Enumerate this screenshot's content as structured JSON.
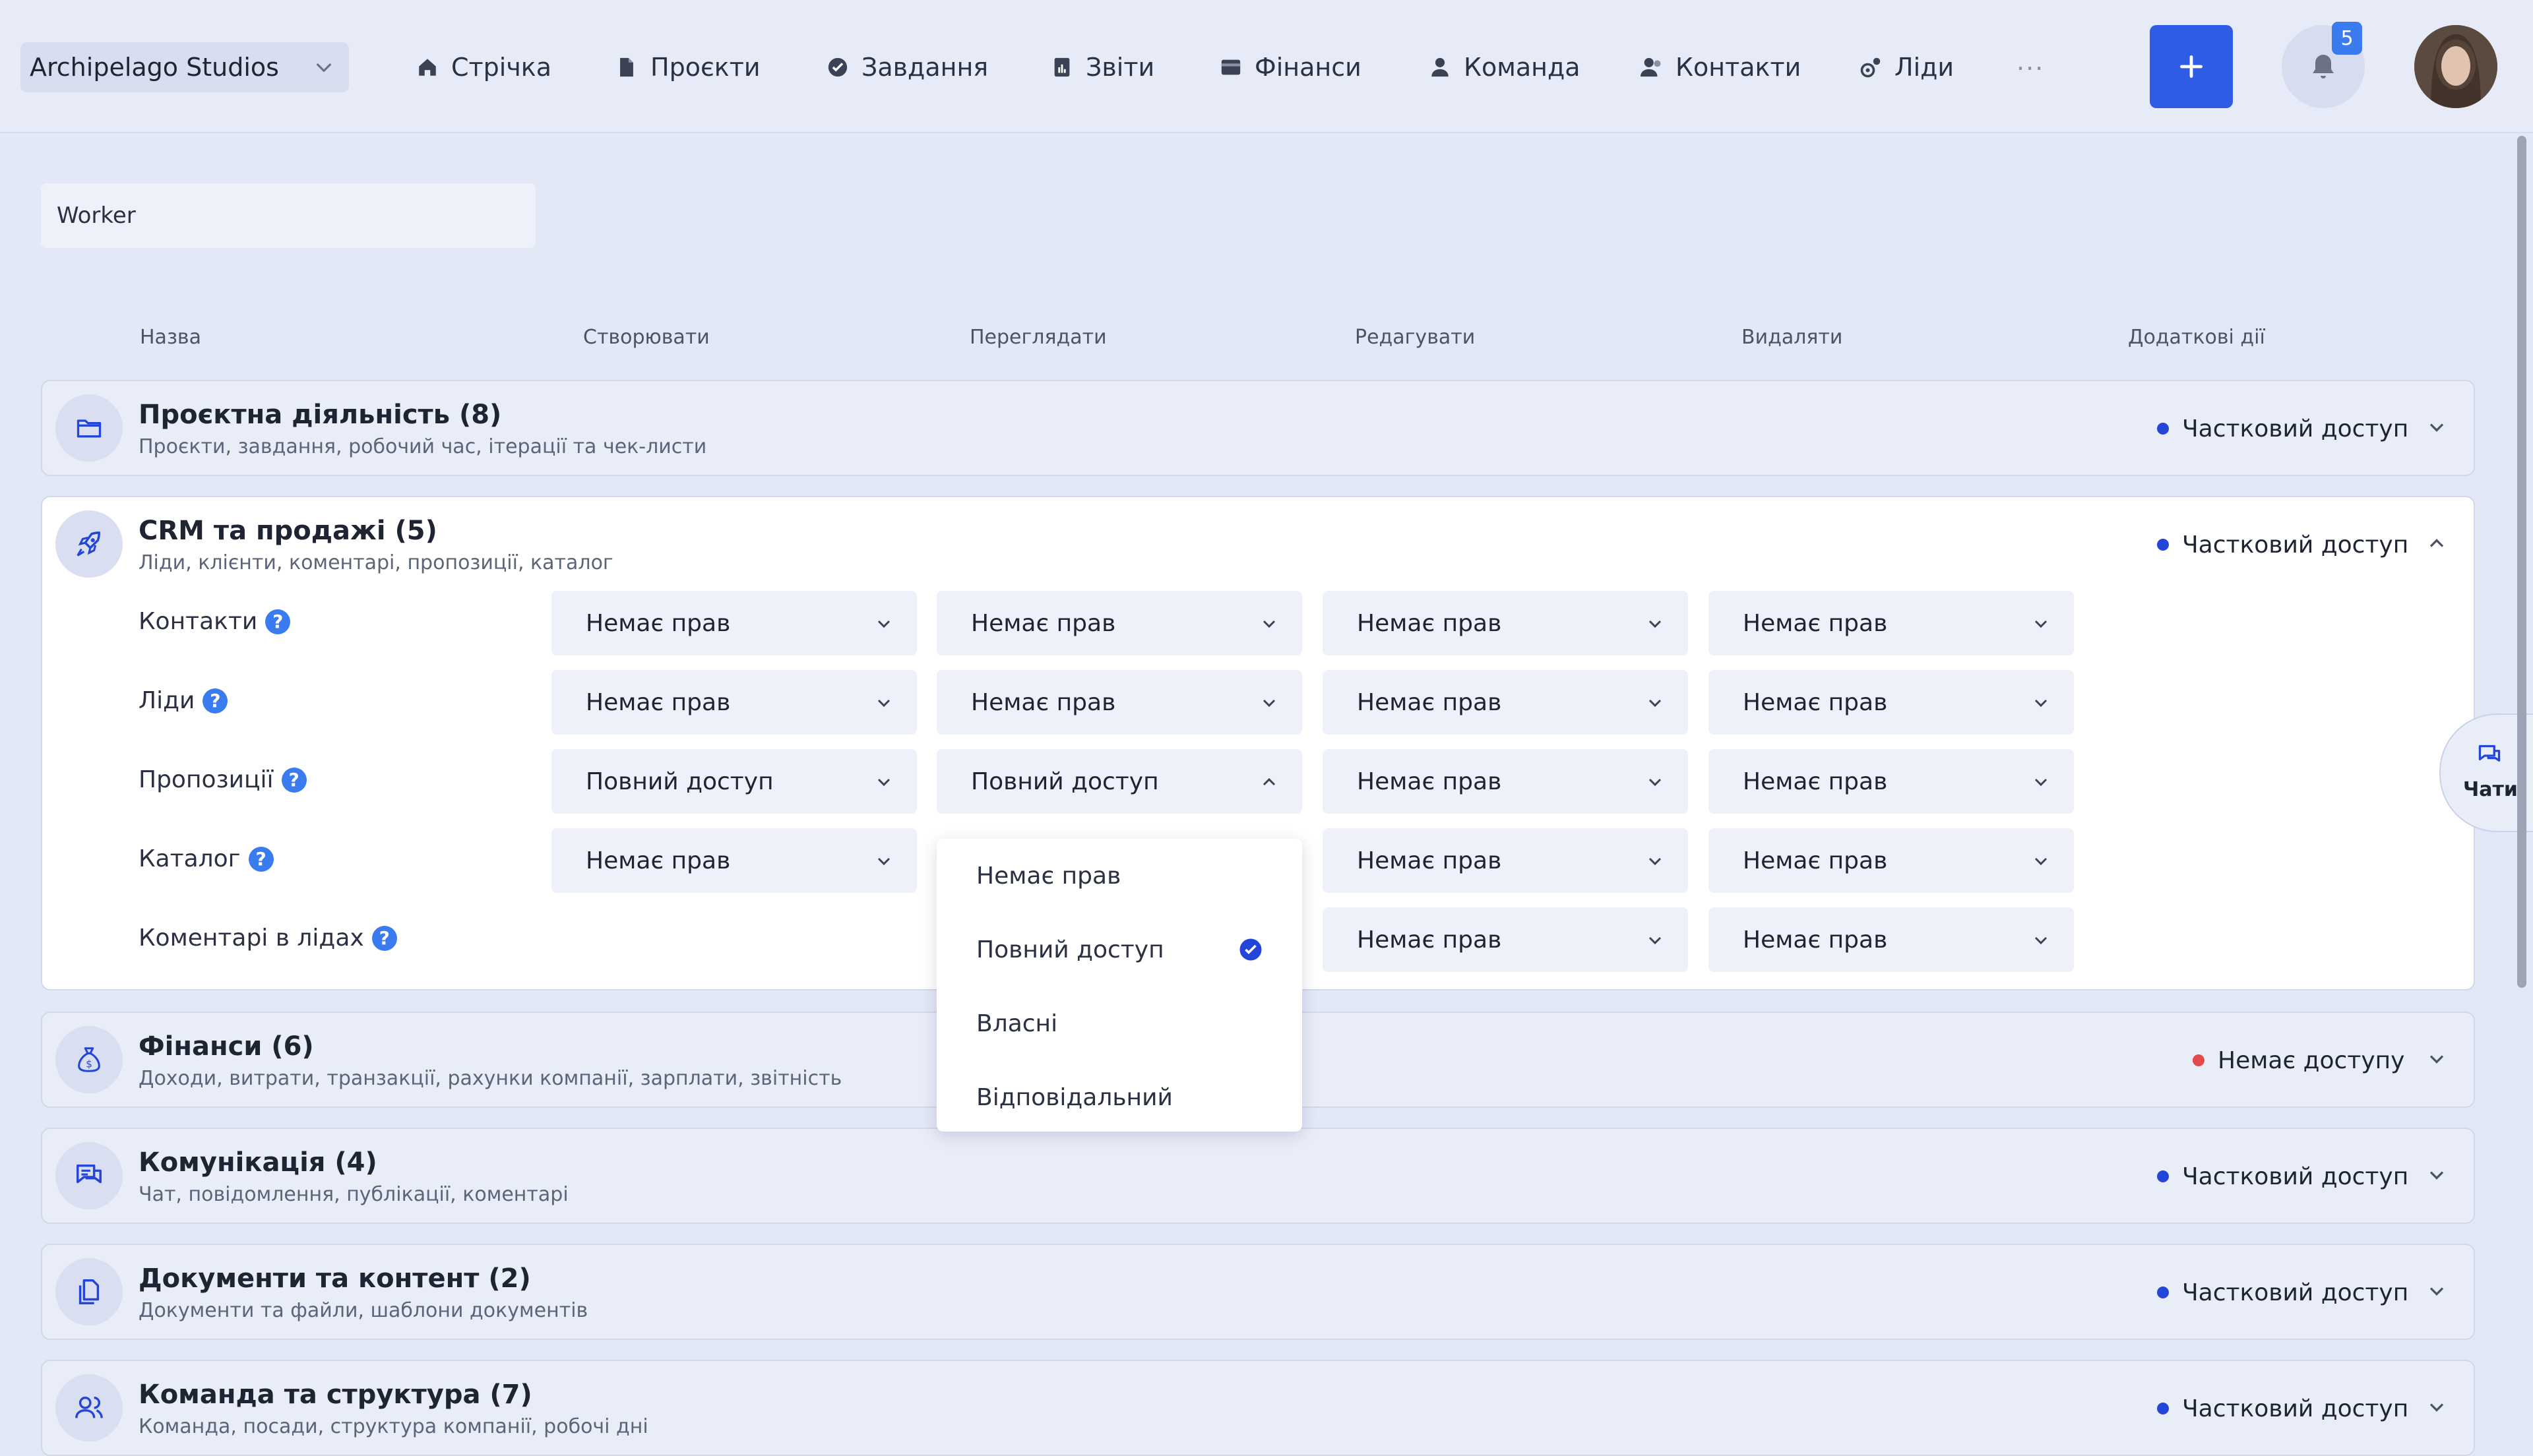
{
  "header": {
    "company": "Archipelago Studios",
    "nav": [
      {
        "label": "Стрічка",
        "icon": "home-icon"
      },
      {
        "label": "Проєкти",
        "icon": "file-icon"
      },
      {
        "label": "Завдання",
        "icon": "check-circle-icon"
      },
      {
        "label": "Звіти",
        "icon": "report-icon"
      },
      {
        "label": "Фінанси",
        "icon": "wallet-icon"
      },
      {
        "label": "Команда",
        "icon": "user-icon"
      },
      {
        "label": "Контакти",
        "icon": "contacts-icon"
      },
      {
        "label": "Ліди",
        "icon": "leads-icon"
      }
    ],
    "more": "···",
    "notifications_count": "5"
  },
  "role_name": "Worker",
  "columns": {
    "name": "Назва",
    "create": "Створювати",
    "view": "Переглядати",
    "edit": "Редагувати",
    "delete": "Видаляти",
    "extra": "Додаткові дії"
  },
  "groups": [
    {
      "title": "Проєктна діяльність (8)",
      "subtitle": "Проєкти, завдання, робочий час, ітерації та чек-листи",
      "status": "Частковий доступ",
      "status_color": "#2346d8",
      "icon": "folder-icon"
    },
    {
      "title": "CRM та продажі (5)",
      "subtitle": "Ліди, клієнти, коментарі, пропозиції, каталог",
      "status": "Частковий доступ",
      "status_color": "#2346d8",
      "icon": "rocket-icon"
    },
    {
      "title": "Фінанси (6)",
      "subtitle": "Доходи, витрати, транзакції, рахунки компанії, зарплати, звітність",
      "status": "Немає доступу",
      "status_color": "#e5484d",
      "icon": "money-bag-icon"
    },
    {
      "title": "Комунікація (4)",
      "subtitle": "Чат, повідомлення, публікації, коментарі",
      "status": "Частковий доступ",
      "status_color": "#2346d8",
      "icon": "chat-icon"
    },
    {
      "title": "Документи та контент (2)",
      "subtitle": "Документи та файли, шаблони документів",
      "status": "Частковий доступ",
      "status_color": "#2346d8",
      "icon": "documents-icon"
    },
    {
      "title": "Команда та структура (7)",
      "subtitle": "Команда, посади, структура компанії, робочі дні",
      "status": "Частковий доступ",
      "status_color": "#2346d8",
      "icon": "team-icon"
    }
  ],
  "crm_rows": [
    {
      "label": "Контакти",
      "create": "Немає прав",
      "view": "Немає прав",
      "edit": "Немає прав",
      "delete": "Немає прав"
    },
    {
      "label": "Ліди",
      "create": "Немає прав",
      "view": "Немає прав",
      "edit": "Немає прав",
      "delete": "Немає прав"
    },
    {
      "label": "Пропозиції",
      "create": "Повний доступ",
      "view": "Повний доступ",
      "edit": "Немає прав",
      "delete": "Немає прав"
    },
    {
      "label": "Каталог",
      "create": "Немає прав",
      "view": "",
      "edit": "Немає прав",
      "delete": "Немає прав"
    },
    {
      "label": "Коментарі в лідах",
      "create": "",
      "view": "",
      "edit": "Немає прав",
      "delete": "Немає прав"
    }
  ],
  "help_mark": "?",
  "dropdown": {
    "options": [
      "Немає прав",
      "Повний доступ",
      "Власні",
      "Відповідальний"
    ],
    "selected": "Повний доступ"
  },
  "chats_label": "Чати"
}
